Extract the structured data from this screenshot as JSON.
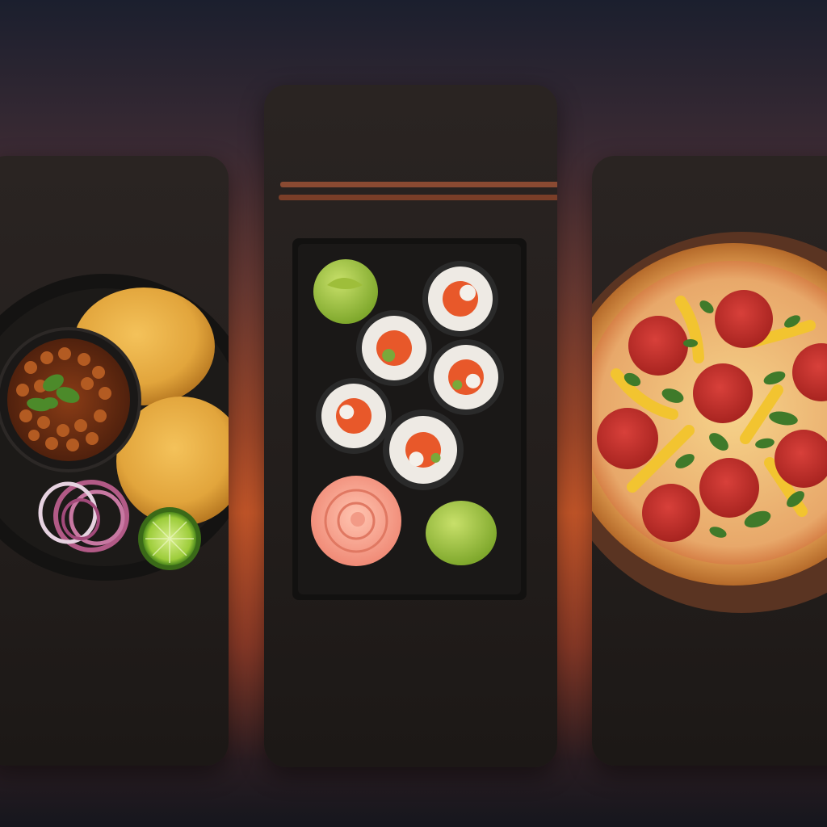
{
  "panels": [
    {
      "dish": "chole-bhature"
    },
    {
      "dish": "sushi-maki-platter"
    },
    {
      "dish": "pepperoni-pizza"
    }
  ]
}
